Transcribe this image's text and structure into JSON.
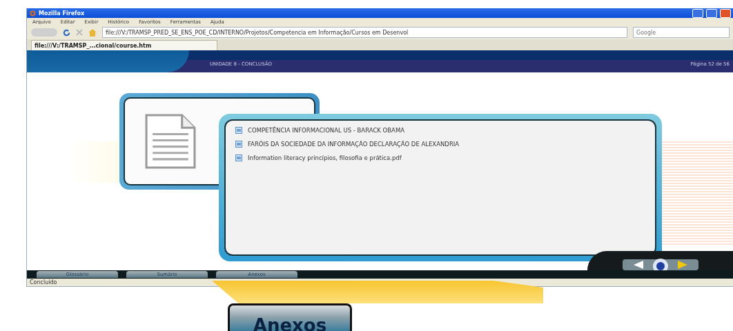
{
  "window": {
    "title": "Mozilla Firefox"
  },
  "menu": [
    "Arquivo",
    "Editar",
    "Exibir",
    "Histórico",
    "Favoritos",
    "Ferramentas",
    "Ajuda"
  ],
  "address_bar": {
    "value": "file:///V:/TRAMSP_PRED_SE_ENS_POE_CD/INTERNO/Projetos/Competencia em Informação/Cursos em Desenvol"
  },
  "search": {
    "placeholder": "Google"
  },
  "tabs": [
    {
      "label": "file:///V:/TRAMSP_...cional/course.htm",
      "selected": true
    }
  ],
  "page": {
    "unit": "UNIDADE 8 - CONCLUSÃO",
    "page_counter": "Página 52 de 56",
    "attachments": [
      "COMPETÊNCIA INFORMACIONAL US - BARACK OBAMA",
      "FARÓIS DA SOCIEDADE DA INFORMAÇÃO DECLARAÇÃO DE ALEXANDRIA",
      "Information literacy princípios, filosofia e prática.pdf"
    ],
    "bottom_tabs": [
      "Glossário",
      "Sumário",
      "Anexos"
    ]
  },
  "status_bar": "Concluído",
  "callout": {
    "label": "Anexos"
  }
}
